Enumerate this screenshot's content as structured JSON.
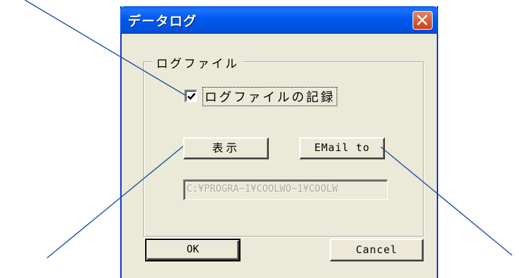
{
  "dialog": {
    "title": "データログ",
    "close_icon": "close-icon",
    "colors": {
      "titlebar": "#0054e3",
      "close_button": "#d95b32",
      "face": "#ebe9d8",
      "callout_line": "#1c4d9e"
    }
  },
  "group": {
    "label": "ログファイル"
  },
  "log_checkbox": {
    "label": "ログファイルの記録",
    "checked": true
  },
  "buttons": {
    "display": "表示",
    "email": "EMail to",
    "ok": "OK",
    "cancel": "Cancel"
  },
  "log_path": {
    "value": "C:¥PROGRA~1¥COOLWO~1¥COOLW",
    "disabled": true
  }
}
